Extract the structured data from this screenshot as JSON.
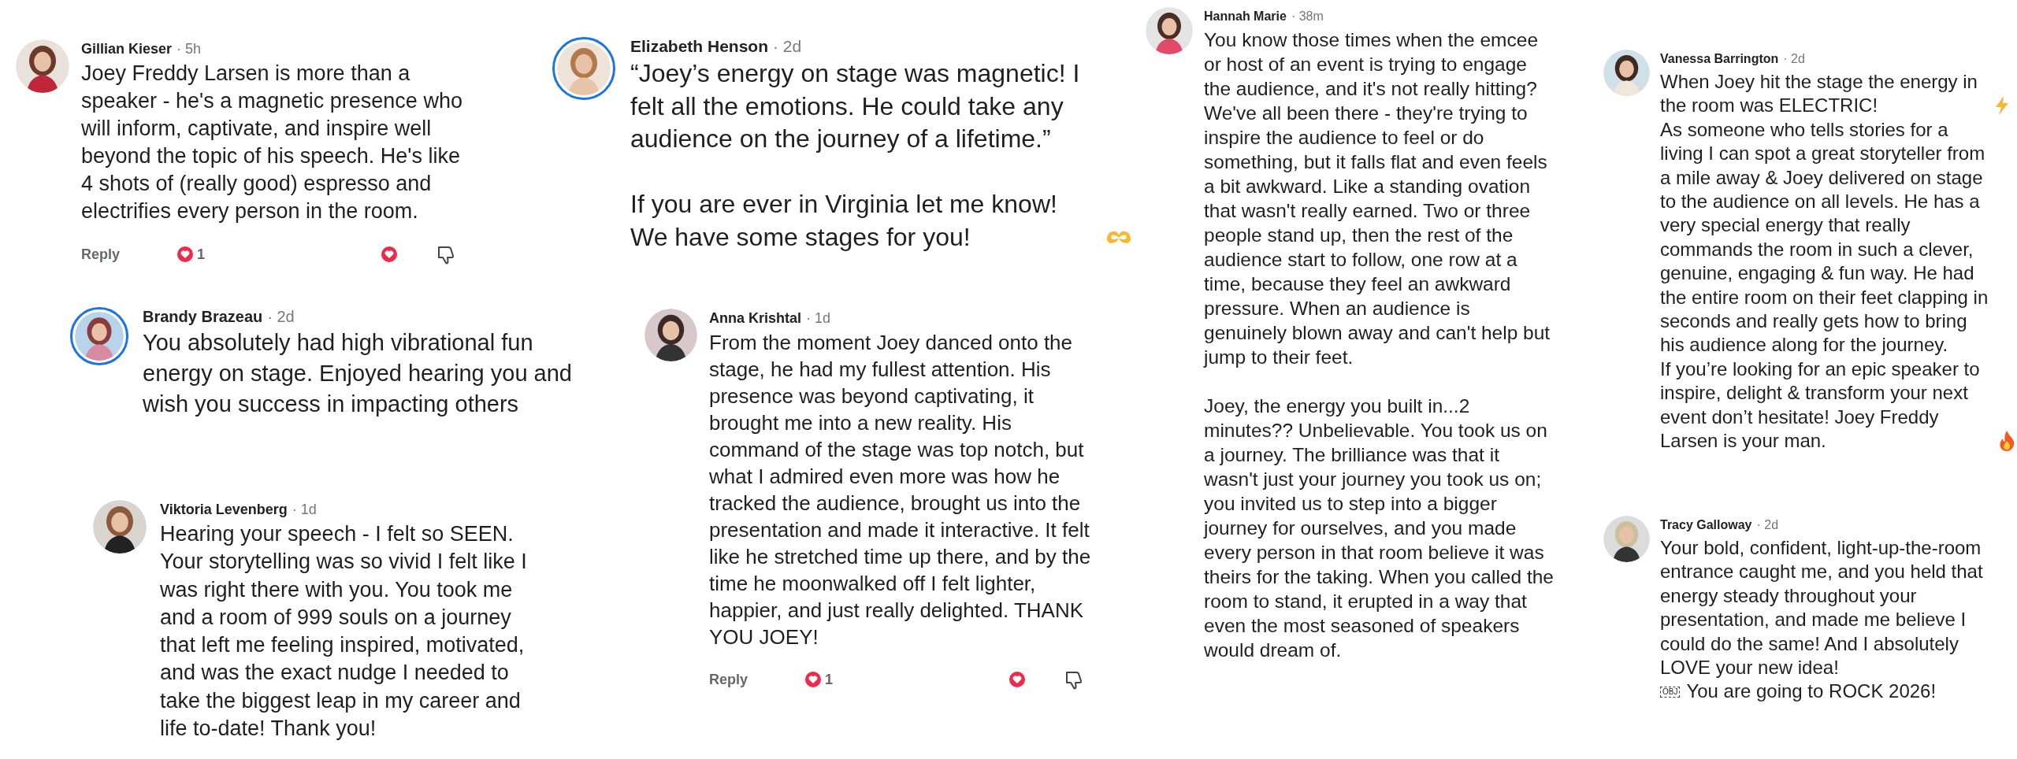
{
  "comments": [
    {
      "author": "Gillian Kieser",
      "time": "· 5h",
      "story_ring": false,
      "paragraphs": [
        {
          "segments": [
            {
              "kind": "text",
              "text": "Joey Freddy Larsen is more than a speaker - he's a magnetic presence who will inform, captivate, and inspire well beyond the topic of his speech. He's like 4 shots of (really good) espresso and electrifies every person in the room."
            }
          ]
        }
      ],
      "actions": {
        "reply": "Reply",
        "likes": "1"
      }
    },
    {
      "author": "Brandy Brazeau",
      "time": "· 2d",
      "story_ring": true,
      "paragraphs": [
        {
          "segments": [
            {
              "kind": "text",
              "text": "You absolutely had high vibrational fun energy on stage. Enjoyed hearing you and wish you success in impacting others"
            }
          ]
        }
      ]
    },
    {
      "author": "Viktoria Levenberg",
      "time": "· 1d",
      "story_ring": false,
      "paragraphs": [
        {
          "segments": [
            {
              "kind": "text",
              "text": "Hearing your speech - I felt so SEEN. Your storytelling was so vivid I felt like I was right there with you. You took me and a room of 999 souls on a journey that left me feeling inspired, motivated, and was the exact nudge I needed to take the biggest leap in my career and life to-date! Thank you!"
            }
          ]
        }
      ]
    },
    {
      "author": "Elizabeth Henson",
      "time": "· 2d",
      "story_ring": true,
      "paragraphs": [
        {
          "segments": [
            {
              "kind": "text",
              "text": "“Joey’s energy on stage was magnetic! I felt all the emotions. He could take any audience on the journey of a lifetime.”\n\nIf you are ever in Virginia let me know! We have some stages for you!"
            },
            {
              "kind": "hands"
            }
          ]
        }
      ]
    },
    {
      "author": "Anna Krishtal",
      "time": "· 1d",
      "story_ring": false,
      "paragraphs": [
        {
          "segments": [
            {
              "kind": "text",
              "text": "From the moment Joey danced onto the stage, he had my fullest attention.  His presence was beyond captivating, it brought me into a new reality.  His command of the stage was top notch, but what I admired even more was how he tracked the audience, brought us into the presentation and made it interactive. It felt like he stretched time up there, and by the time he moonwalked off I felt lighter, happier, and just really delighted. THANK YOU JOEY!"
            }
          ]
        }
      ],
      "actions": {
        "reply": "Reply",
        "likes": "1"
      }
    },
    {
      "author": "Hannah Marie",
      "time": "· 38m",
      "story_ring": false,
      "paragraphs": [
        {
          "segments": [
            {
              "kind": "text",
              "text": "You know those times when the emcee or host of an event is trying to engage the audience, and it's not really hitting? We've all been there - they're trying to inspire the audience to feel or do something, but it falls flat and even feels a bit awkward. Like a standing ovation that wasn't really earned. Two or three people stand up, then the rest of the audience start to follow, one row at a time, because they feel an awkward pressure. When an audience is genuinely blown away and can't help but jump to their feet.\n\nJoey, the energy you built in...2 minutes?? Unbelievable. You took us on a journey. The brilliance was that it wasn't just your journey you took us on; you invited us to step into a bigger journey for ourselves, and you made every person in that room believe it was theirs for the taking. When you called the room to stand, it erupted in a way that even the most seasoned of speakers would dream of."
            }
          ]
        }
      ]
    },
    {
      "author": "Vanessa Barrington",
      "time": "· 2d",
      "story_ring": false,
      "paragraphs": [
        {
          "segments": [
            {
              "kind": "text",
              "text": "When Joey hit the stage the energy in the room was ELECTRIC!"
            },
            {
              "kind": "bolt"
            }
          ]
        },
        {
          "segments": [
            {
              "kind": "text",
              "text": "As someone who tells stories for a living I can spot a great storyteller from a mile away & Joey delivered on stage to the audience on all levels. He has a very special energy that really commands the room in such a clever, genuine, engaging & fun way. He had the entire room on their feet clapping in seconds and really gets how to bring his audience along for the journey.\nIf you’re looking for an epic speaker to inspire, delight & transform your next event don’t hesitate! Joey Freddy Larsen is your man."
            },
            {
              "kind": "fire"
            }
          ]
        }
      ]
    },
    {
      "author": "Tracy Galloway",
      "time": "· 2d",
      "story_ring": false,
      "paragraphs": [
        {
          "segments": [
            {
              "kind": "text",
              "text": "Your bold, confident, light-up-the-room entrance caught me, and you held that energy steady throughout your presentation, and made me believe I could do the same! And I absolutely LOVE your new idea!"
            },
            {
              "kind": "object",
              "text": "OBJ"
            },
            {
              "kind": "text",
              "text": "You are going to ROCK 2026!"
            }
          ]
        }
      ]
    }
  ]
}
